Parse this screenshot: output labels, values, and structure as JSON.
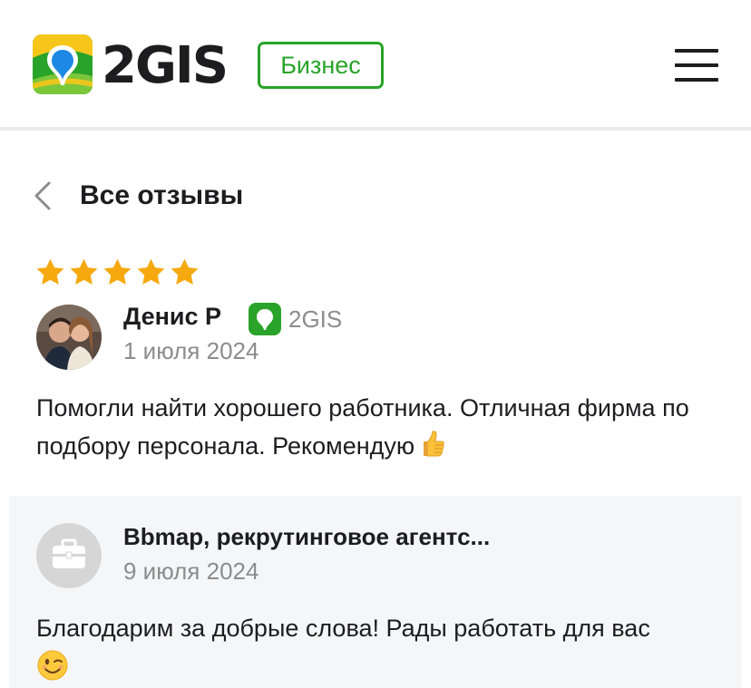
{
  "header": {
    "brand": "2GIS",
    "badge": "Бизнес",
    "menu_icon": "hamburger-menu-icon",
    "colors": {
      "brand_green": "#29a329",
      "text": "#1d1d1f"
    }
  },
  "nav": {
    "back_label": "Все отзывы",
    "back_icon": "chevron-left-icon"
  },
  "review": {
    "rating": 5,
    "max_rating": 5,
    "star_color": "#f5a90e",
    "author": "Денис Р",
    "source": "2GIS",
    "date": "1 июля 2024",
    "text": "Помогли найти хорошего работника. Отличная фирма по подбору персонала. Рекомендую",
    "text_emoji": "thumbs-up-emoji"
  },
  "reply": {
    "author": "Bbmap, рекрутинговое агентс...",
    "date": "9 июля 2024",
    "text": "Благодарим за добрые слова! Рады работать для вас",
    "text_emoji": "winking-face-emoji",
    "avatar_icon": "briefcase-icon"
  }
}
